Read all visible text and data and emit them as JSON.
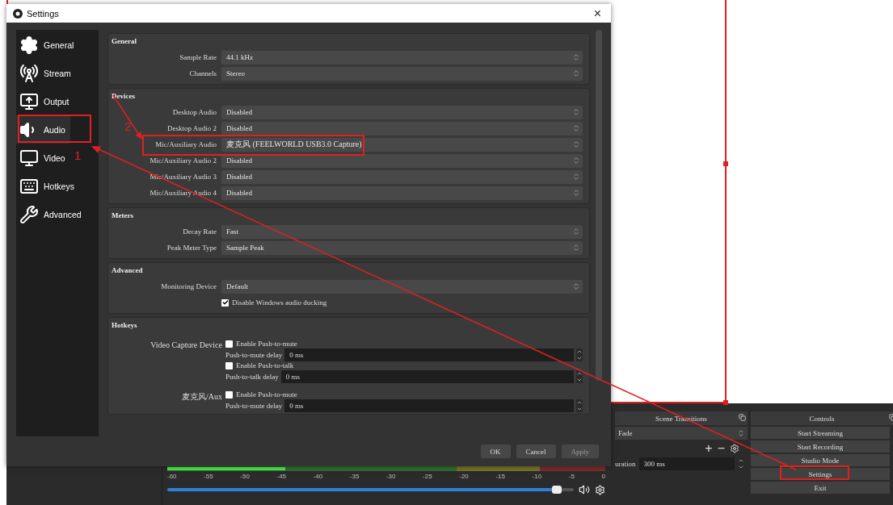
{
  "dialog": {
    "title": "Settings",
    "close": "×",
    "sidebar": [
      {
        "label": "General",
        "selected": false
      },
      {
        "label": "Stream",
        "selected": false
      },
      {
        "label": "Output",
        "selected": false
      },
      {
        "label": "Audio",
        "selected": true
      },
      {
        "label": "Video",
        "selected": false
      },
      {
        "label": "Hotkeys",
        "selected": false
      },
      {
        "label": "Advanced",
        "selected": false
      }
    ],
    "sections": [
      {
        "title": "General",
        "rows": [
          {
            "kind": "select",
            "label": "Sample Rate",
            "value": "44.1 kHz"
          },
          {
            "kind": "select",
            "label": "Channels",
            "value": "Stereo"
          }
        ]
      },
      {
        "title": "Devices",
        "rows": [
          {
            "kind": "select",
            "label": "Desktop Audio",
            "value": "Disabled"
          },
          {
            "kind": "select",
            "label": "Desktop Audio 2",
            "value": "Disabled"
          },
          {
            "kind": "select",
            "label": "Mic/Auxiliary Audio",
            "value": "麦克风 (FEELWORLD USB3.0 Capture)"
          },
          {
            "kind": "select",
            "label": "Mic/Auxiliary Audio 2",
            "value": "Disabled"
          },
          {
            "kind": "select",
            "label": "Mic/Auxiliary Audio 3",
            "value": "Disabled"
          },
          {
            "kind": "select",
            "label": "Mic/Auxiliary Audio 4",
            "value": "Disabled"
          }
        ]
      },
      {
        "title": "Meters",
        "rows": [
          {
            "kind": "select",
            "label": "Decay Rate",
            "value": "Fast"
          },
          {
            "kind": "select",
            "label": "Peak Meter Type",
            "value": "Sample Peak"
          }
        ]
      },
      {
        "title": "Advanced",
        "rows": [
          {
            "kind": "select",
            "label": "Monitoring Device",
            "value": "Default"
          },
          {
            "kind": "checkbox",
            "label": "Disable Windows audio ducking",
            "checked": true
          }
        ]
      },
      {
        "title": "Hotkeys",
        "rows": [
          {
            "kind": "hotkey",
            "source": "Video Capture Device",
            "controls": [
              {
                "kind": "checkbox",
                "label": "Enable Push-to-mute",
                "checked": false
              },
              {
                "kind": "delay",
                "label": "Push-to-mute delay",
                "value": "0 ms"
              },
              {
                "kind": "checkbox",
                "label": "Enable Push-to-talk",
                "checked": false
              },
              {
                "kind": "delay",
                "label": "Push-to-talk delay",
                "value": "0 ms"
              }
            ]
          },
          {
            "kind": "hotkey",
            "source": "麦克风/Aux",
            "controls": [
              {
                "kind": "checkbox",
                "label": "Enable Push-to-mute",
                "checked": false
              },
              {
                "kind": "delay",
                "label": "Push-to-mute delay",
                "value": "0 ms"
              }
            ]
          }
        ]
      }
    ],
    "buttons": [
      {
        "label": "OK",
        "disabled": false
      },
      {
        "label": "Cancel",
        "disabled": false
      },
      {
        "label": "Apply",
        "disabled": true
      }
    ]
  },
  "mixer": {
    "meter": {
      "level": 0.27
    },
    "scale": [
      "-60",
      "-55",
      "-50",
      "-45",
      "-40",
      "-35",
      "-30",
      "-25",
      "-20",
      "-15",
      "-10",
      "-5",
      "0"
    ],
    "volume": {
      "level": 0.97
    }
  },
  "scene_transitions": {
    "title": "Scene Transitions",
    "transition": "Fade",
    "add": "+",
    "remove": "−",
    "duration_label": "uration",
    "duration": "300 ms"
  },
  "controls": {
    "title": "Controls",
    "buttons": [
      {
        "label": "Start Streaming"
      },
      {
        "label": "Start Recording"
      },
      {
        "label": "Studio Mode"
      },
      {
        "label": "Settings"
      },
      {
        "label": "Exit"
      }
    ]
  },
  "annotations": {
    "steps": [
      "1",
      "2"
    ]
  }
}
